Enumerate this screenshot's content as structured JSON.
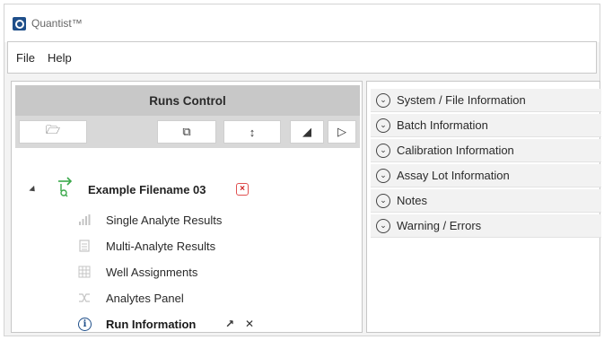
{
  "app": {
    "title": "Quantist™"
  },
  "menu": {
    "items": [
      "File",
      "Help"
    ]
  },
  "runs_control": {
    "title": "Runs Control",
    "toolbar": {
      "open_icon": "🗁",
      "copy_icon": "⧉",
      "sort_icon": "↕",
      "triangle_icon": "◢",
      "play_icon": "▷"
    },
    "file": {
      "name": "Example Filename 03",
      "close_glyph": "×"
    },
    "children": [
      {
        "label": "Single Analyte Results",
        "icon": "chart-icon"
      },
      {
        "label": "Multi-Analyte Results",
        "icon": "document-icon"
      },
      {
        "label": "Well Assignments",
        "icon": "grid-icon"
      },
      {
        "label": "Analytes Panel",
        "icon": "shuffle-icon"
      },
      {
        "label": "Run Information",
        "icon": "info-icon",
        "active": true,
        "popout_glyph": "↗",
        "close_glyph": "✕"
      }
    ]
  },
  "info_sections": [
    {
      "label": "System / File Information"
    },
    {
      "label": "Batch Information"
    },
    {
      "label": "Calibration Information"
    },
    {
      "label": "Assay Lot Information"
    },
    {
      "label": "Notes"
    },
    {
      "label": "Warning / Errors"
    }
  ],
  "colors": {
    "accent": "#1f4f8a",
    "file_icon_green": "#3aa84a",
    "close_red": "#d02020"
  }
}
